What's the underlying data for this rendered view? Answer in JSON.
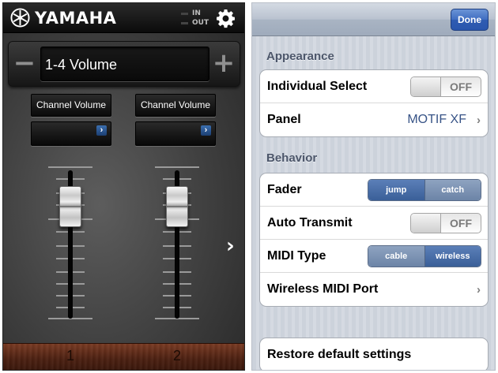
{
  "left_panel": {
    "brand": "YAMAHA",
    "io_labels": [
      "IN",
      "OUT"
    ],
    "volume_display": "1-4 Volume",
    "volume_minus": "−",
    "volume_plus": "+",
    "channels": [
      {
        "label_button": "Channel Volume",
        "number": "1",
        "fader_level": 0.83
      },
      {
        "label_button": "Channel Volume",
        "number": "2",
        "fader_level": 0.83
      }
    ],
    "select_chevron": "›",
    "next_page_arrow": "›",
    "icons": [
      "yamaha-logo-icon",
      "gear-icon",
      "chevron-right-icon"
    ]
  },
  "right_panel": {
    "done_label": "Done",
    "sections": {
      "appearance": {
        "title": "Appearance",
        "individual_select": {
          "label": "Individual Select",
          "toggle": "OFF"
        },
        "panel": {
          "label": "Panel",
          "value": "MOTIF XF"
        }
      },
      "behavior": {
        "title": "Behavior",
        "fader": {
          "label": "Fader",
          "options": [
            "jump",
            "catch"
          ],
          "selected": "jump"
        },
        "auto_transmit": {
          "label": "Auto Transmit",
          "toggle": "OFF"
        },
        "midi_type": {
          "label": "MIDI Type",
          "options": [
            "cable",
            "wireless"
          ],
          "selected": "wireless"
        },
        "wireless_midi_port": {
          "label": "Wireless MIDI Port"
        }
      }
    },
    "restore_label": "Restore default settings",
    "disclosure_glyph": "›",
    "colors": {
      "done_button": "#3f6cc1",
      "selected_segment": "#3a5f98",
      "value_text": "#385487"
    }
  }
}
